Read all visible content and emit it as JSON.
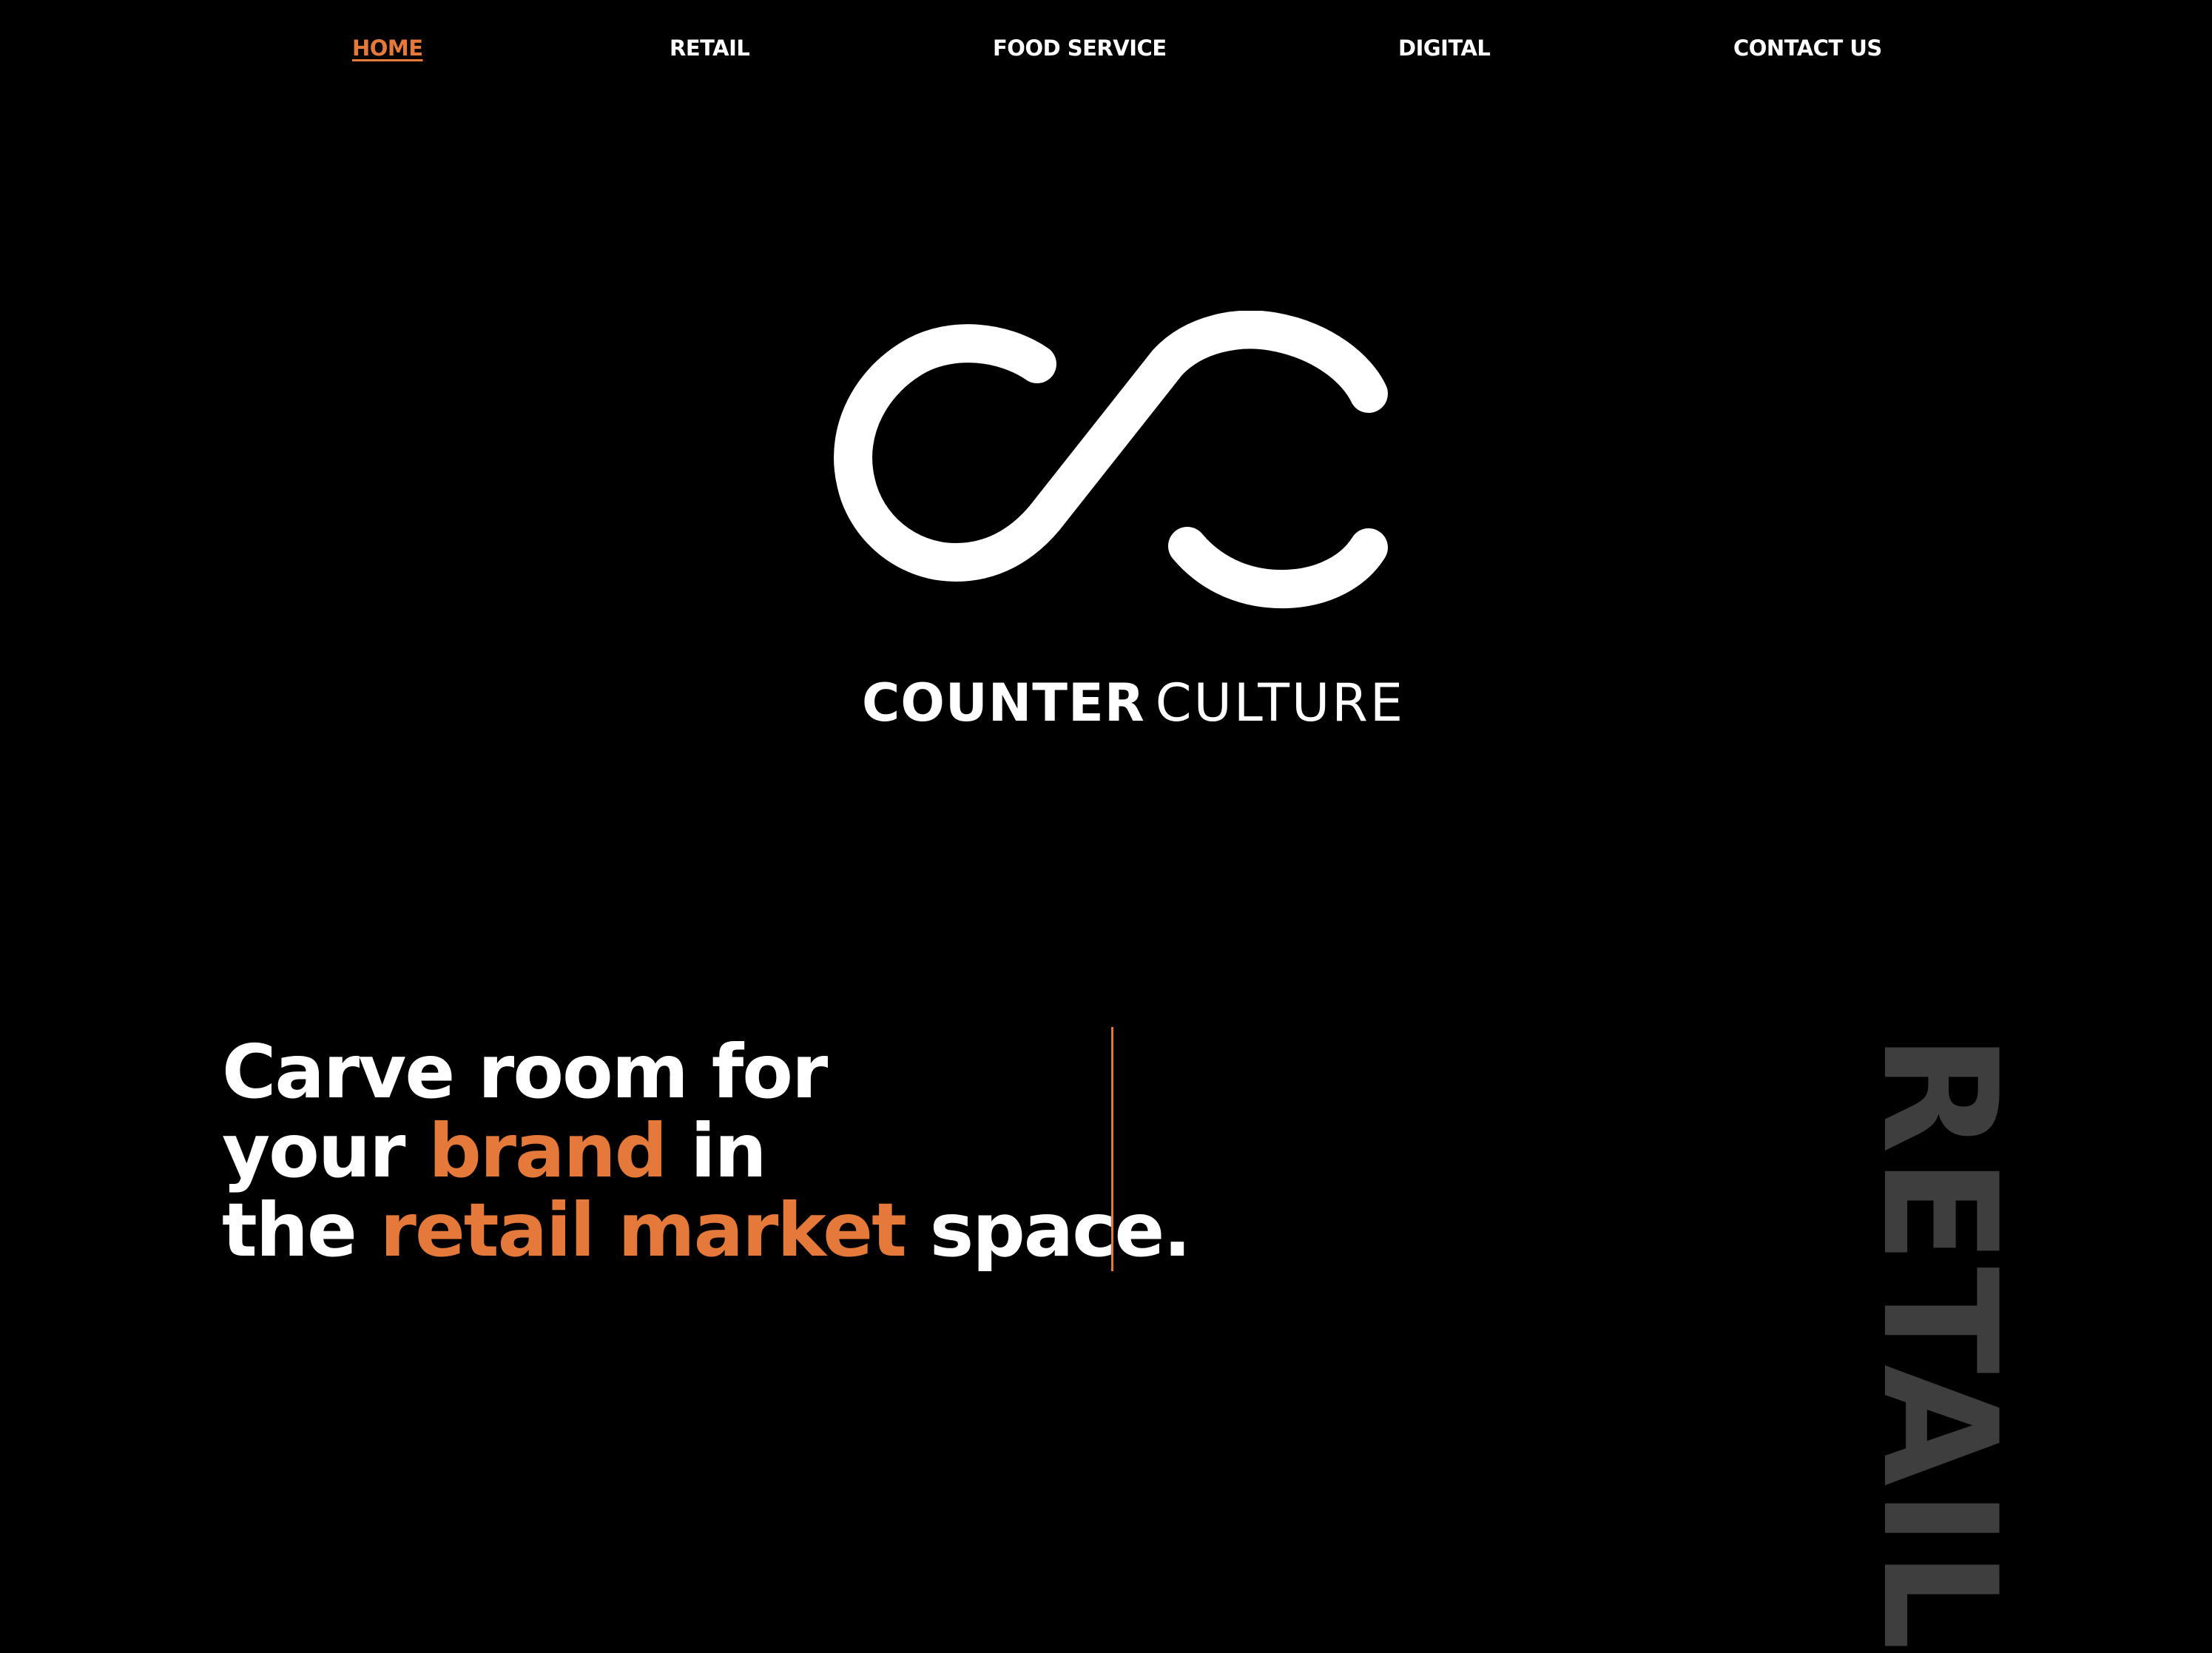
{
  "nav": {
    "items": [
      {
        "label": "HOME",
        "active": true
      },
      {
        "label": "RETAIL",
        "active": false
      },
      {
        "label": "FOOD SERVICE",
        "active": false
      },
      {
        "label": "DIGITAL",
        "active": false
      },
      {
        "label": "CONTACT US",
        "active": false
      }
    ]
  },
  "logo": {
    "wordmark_bold": "COUNTER",
    "wordmark_light": "CULTURE"
  },
  "hero": {
    "line1": "Carve room for",
    "line2_a": "your ",
    "line2_accent": "brand",
    "line2_b": " in",
    "line3_a": "the ",
    "line3_accent": "retail market",
    "line3_b": " space."
  },
  "side_label": "RETAIL",
  "colors": {
    "background": "#000000",
    "text": "#ffffff",
    "accent": "#e4793a",
    "muted": "#3e3e3e"
  }
}
